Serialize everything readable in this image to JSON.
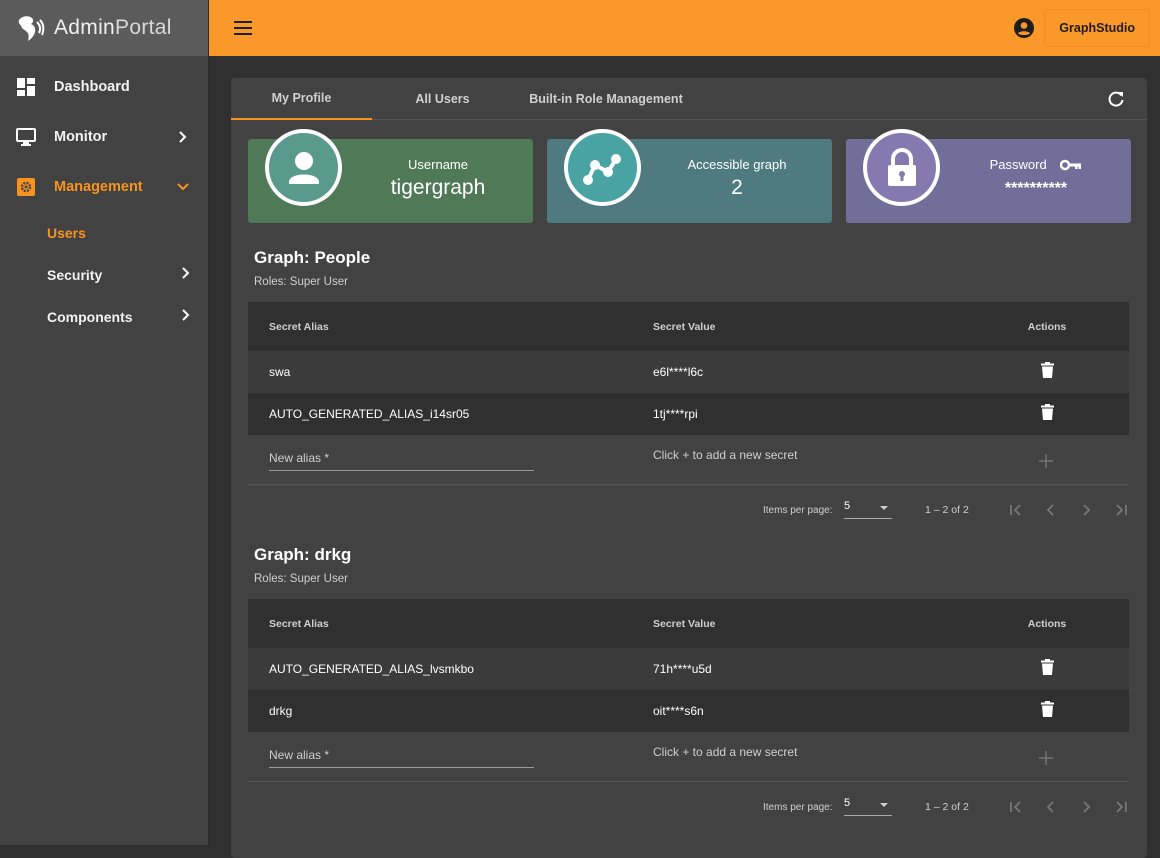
{
  "app": {
    "logo_bold": "Admin",
    "logo_light": "Portal",
    "logo_icon": "tiger-icon"
  },
  "topbar": {
    "menu_icon": "hamburger-icon",
    "account_icon": "account-circle-icon",
    "graphstudio_label": "GraphStudio"
  },
  "sidebar": {
    "items": [
      {
        "label": "Dashboard",
        "icon": "dashboard-icon"
      },
      {
        "label": "Monitor",
        "icon": "monitor-icon",
        "chevron": "chevron-right-icon"
      },
      {
        "label": "Management",
        "icon": "management-gear-icon",
        "chevron": "chevron-down-icon",
        "active": true
      }
    ],
    "sub_items": [
      {
        "label": "Users",
        "active": true
      },
      {
        "label": "Security",
        "chevron": "chevron-right-icon"
      },
      {
        "label": "Components",
        "chevron": "chevron-right-icon"
      }
    ],
    "accent": "#f7931e"
  },
  "tabs": [
    {
      "label": "My Profile",
      "active": true
    },
    {
      "label": "All Users"
    },
    {
      "label": "Built-in Role Management"
    }
  ],
  "stats": [
    {
      "label": "Username",
      "value": "tigergraph",
      "icon": "user-icon",
      "color": "#507a57"
    },
    {
      "label": "Accessible graph",
      "value": "2",
      "icon": "graph-icon",
      "color": "#4e7a80"
    },
    {
      "label": "Password",
      "value": "**********",
      "icon": "lock-icon",
      "extra_icon": "key-icon",
      "color": "#716f99"
    }
  ],
  "graphs": [
    {
      "title": "Graph: People",
      "roles": "Roles: Super User",
      "columns": [
        "Secret Alias",
        "Secret Value",
        "Actions"
      ],
      "rows": [
        {
          "alias": "swa",
          "value": "e6l****l6c"
        },
        {
          "alias": "AUTO_GENERATED_ALIAS_i14sr05",
          "value": "1tj****rpi"
        }
      ],
      "new_alias_placeholder": "New alias *",
      "hint": "Click + to add a new secret",
      "pager": {
        "items_per_page_label": "Items per page:",
        "items_per_page": "5",
        "range": "1 – 2 of 2"
      }
    },
    {
      "title": "Graph: drkg",
      "roles": "Roles: Super User",
      "columns": [
        "Secret Alias",
        "Secret Value",
        "Actions"
      ],
      "rows": [
        {
          "alias": "AUTO_GENERATED_ALIAS_lvsmkbo",
          "value": "71h****u5d"
        },
        {
          "alias": "drkg",
          "value": "oit****s6n"
        }
      ],
      "new_alias_placeholder": "New alias *",
      "hint": "Click + to add a new secret",
      "pager": {
        "items_per_page_label": "Items per page:",
        "items_per_page": "5",
        "range": "1 – 2 of 2"
      }
    }
  ]
}
